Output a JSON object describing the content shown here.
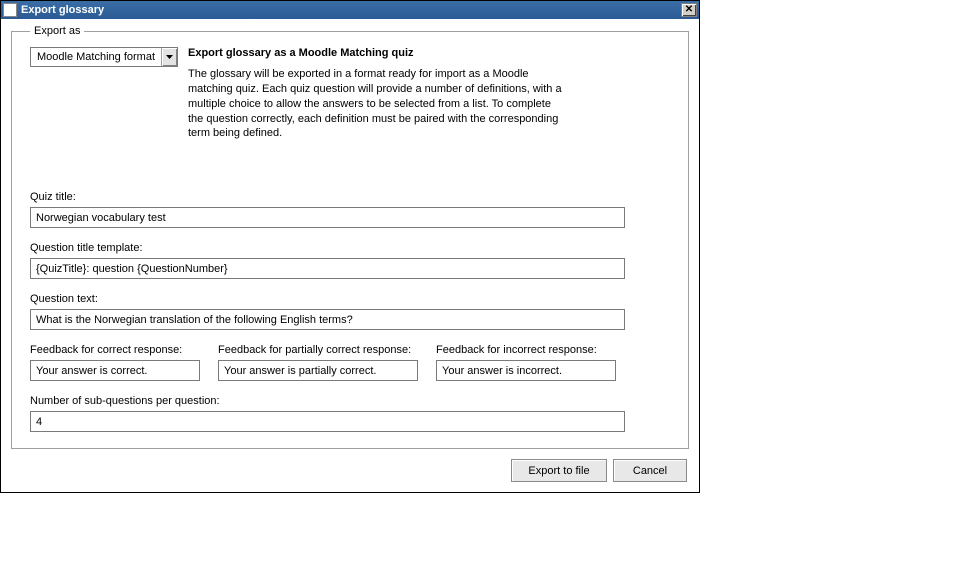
{
  "window": {
    "title": "Export glossary"
  },
  "fieldset": {
    "legend": "Export as"
  },
  "format": {
    "selected": "Moodle Matching format"
  },
  "description": {
    "title": "Export glossary as a Moodle Matching quiz",
    "text": "The glossary will be exported in a format ready for import as a Moodle matching quiz. Each quiz question will provide a number of definitions, with a multiple choice to allow the answers to be selected from a list. To complete the question correctly, each definition must be paired with the corresponding term being defined."
  },
  "labels": {
    "quiz_title": "Quiz title:",
    "question_title_template": "Question title template:",
    "question_text": "Question text:",
    "feedback_correct": "Feedback for correct response:",
    "feedback_partial": "Feedback for partially correct response:",
    "feedback_incorrect": "Feedback for incorrect response:",
    "num_subquestions": "Number of sub-questions per question:"
  },
  "values": {
    "quiz_title": "Norwegian vocabulary test",
    "question_title_template": "{QuizTitle}: question {QuestionNumber}",
    "question_text": "What is the Norwegian translation of the following English terms?",
    "feedback_correct": "Your answer is correct.",
    "feedback_partial": "Your answer is partially correct.",
    "feedback_incorrect": "Your answer is incorrect.",
    "num_subquestions": "4"
  },
  "buttons": {
    "export": "Export to file",
    "cancel": "Cancel"
  }
}
